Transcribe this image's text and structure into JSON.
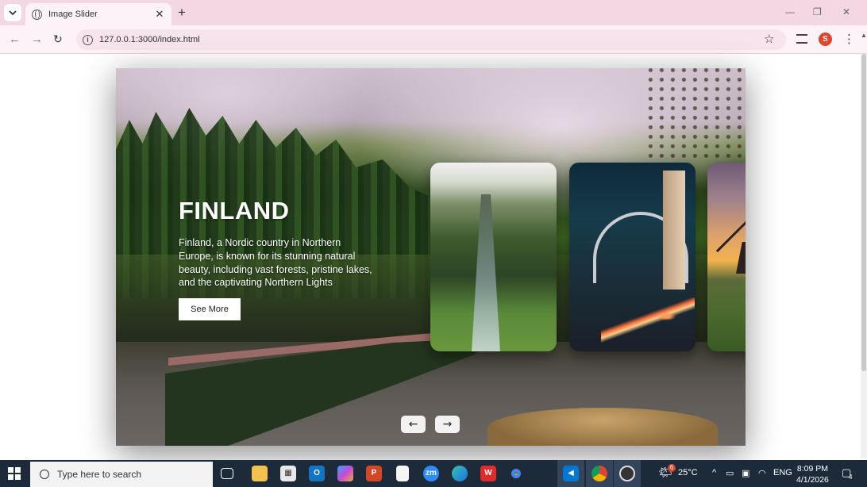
{
  "browser": {
    "tab_title": "Image Slider",
    "url": "127.0.0.1:3000/index.html",
    "profile_initial": "S"
  },
  "slide": {
    "title": "FINLAND",
    "description": "Finland, a Nordic country in Northern Europe, is known for its stunning natural beauty, including vast forests, pristine lakes, and the captivating Northern Lights",
    "button_label": "See More"
  },
  "thumbnails": [
    "gorge-landscape",
    "harbour-bridge-night",
    "windmill-sunset",
    "partial-next-card"
  ],
  "controls": {
    "prev_label": "←",
    "next_label": "→"
  },
  "taskbar": {
    "search_placeholder": "Type here to search",
    "weather": "25°C",
    "weather_badge": "6",
    "language": "ENG",
    "time": "8:09 PM",
    "date": "4/1/2026",
    "notification_count": "4",
    "apps": [
      "task-view",
      "file-explorer",
      "microsoft-store",
      "outlook",
      "copilot",
      "powerpoint",
      "notepad",
      "zoom",
      "edge",
      "wps-office",
      "chrome",
      "vscode",
      "chrome-profile",
      "obs"
    ]
  },
  "colors": {
    "tabbar": "#f3d7e3",
    "taskbar": "#1d2a3a",
    "accent_profile": "#e0442b"
  }
}
